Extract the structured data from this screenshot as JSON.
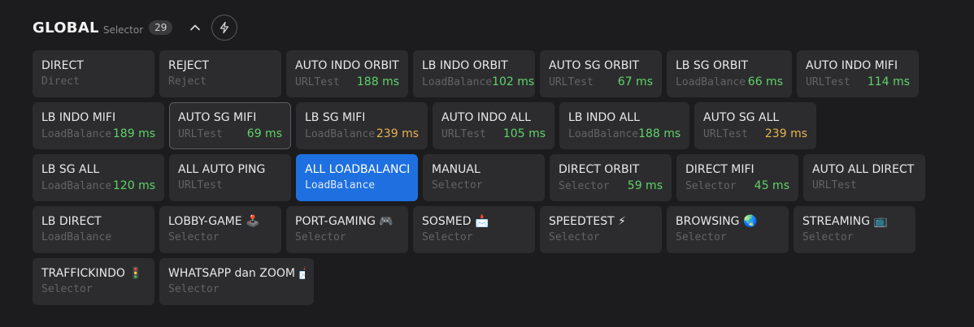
{
  "header": {
    "title": "GLOBAL",
    "subtitle": "Selector",
    "count": "29",
    "collapse_icon": "chevron-up-icon",
    "test_icon": "lightning-icon"
  },
  "colors": {
    "selected": "#1e6fe0",
    "delay_good": "#5fd36a",
    "delay_medium": "#e6b450"
  },
  "proxies": [
    {
      "name": "DIRECT",
      "type": "Direct",
      "delay": ""
    },
    {
      "name": "REJECT",
      "type": "Reject",
      "delay": ""
    },
    {
      "name": "AUTO INDO ORBIT",
      "type": "URLTest",
      "delay": "188 ms"
    },
    {
      "name": "LB INDO ORBIT",
      "type": "LoadBalance",
      "delay": "102 ms"
    },
    {
      "name": "AUTO SG ORBIT",
      "type": "URLTest",
      "delay": "67 ms"
    },
    {
      "name": "LB SG ORBIT",
      "type": "LoadBalance",
      "delay": "66 ms"
    },
    {
      "name": "AUTO INDO MIFI",
      "type": "URLTest",
      "delay": "114 ms"
    },
    {
      "name": "LB INDO MIFI",
      "type": "LoadBalance",
      "delay": "189 ms"
    },
    {
      "name": "AUTO SG MIFI",
      "type": "URLTest",
      "delay": "69 ms"
    },
    {
      "name": "LB SG MIFI",
      "type": "LoadBalance",
      "delay": "239 ms"
    },
    {
      "name": "AUTO INDO ALL",
      "type": "URLTest",
      "delay": "105 ms"
    },
    {
      "name": "LB INDO ALL",
      "type": "LoadBalance",
      "delay": "188 ms"
    },
    {
      "name": "AUTO SG ALL",
      "type": "URLTest",
      "delay": "239 ms"
    },
    {
      "name": "LB SG ALL",
      "type": "LoadBalance",
      "delay": "120 ms"
    },
    {
      "name": "ALL AUTO PING",
      "type": "URLTest",
      "delay": ""
    },
    {
      "name": "ALL LOADBALANCE",
      "type": "LoadBalance",
      "delay": ""
    },
    {
      "name": "MANUAL",
      "type": "Selector",
      "delay": ""
    },
    {
      "name": "DIRECT ORBIT",
      "type": "Selector",
      "delay": "59 ms"
    },
    {
      "name": "DIRECT MIFI",
      "type": "Selector",
      "delay": "45 ms"
    },
    {
      "name": "AUTO ALL DIRECT",
      "type": "URLTest",
      "delay": ""
    },
    {
      "name": "LB DIRECT",
      "type": "LoadBalance",
      "delay": ""
    },
    {
      "name": "LOBBY-GAME 🕹️",
      "type": "Selector",
      "delay": ""
    },
    {
      "name": "PORT-GAMING 🎮",
      "type": "Selector",
      "delay": ""
    },
    {
      "name": "SOSMED 📩",
      "type": "Selector",
      "delay": ""
    },
    {
      "name": "SPEEDTEST ⚡",
      "type": "Selector",
      "delay": ""
    },
    {
      "name": "BROWSING 🌏",
      "type": "Selector",
      "delay": ""
    },
    {
      "name": "STREAMING 📺",
      "type": "Selector",
      "delay": ""
    },
    {
      "name": "TRAFFICKINDO 🚦",
      "type": "Selector",
      "delay": ""
    },
    {
      "name": "WHATSAPP dan ZOOM 📩",
      "type": "Selector",
      "delay": ""
    }
  ]
}
